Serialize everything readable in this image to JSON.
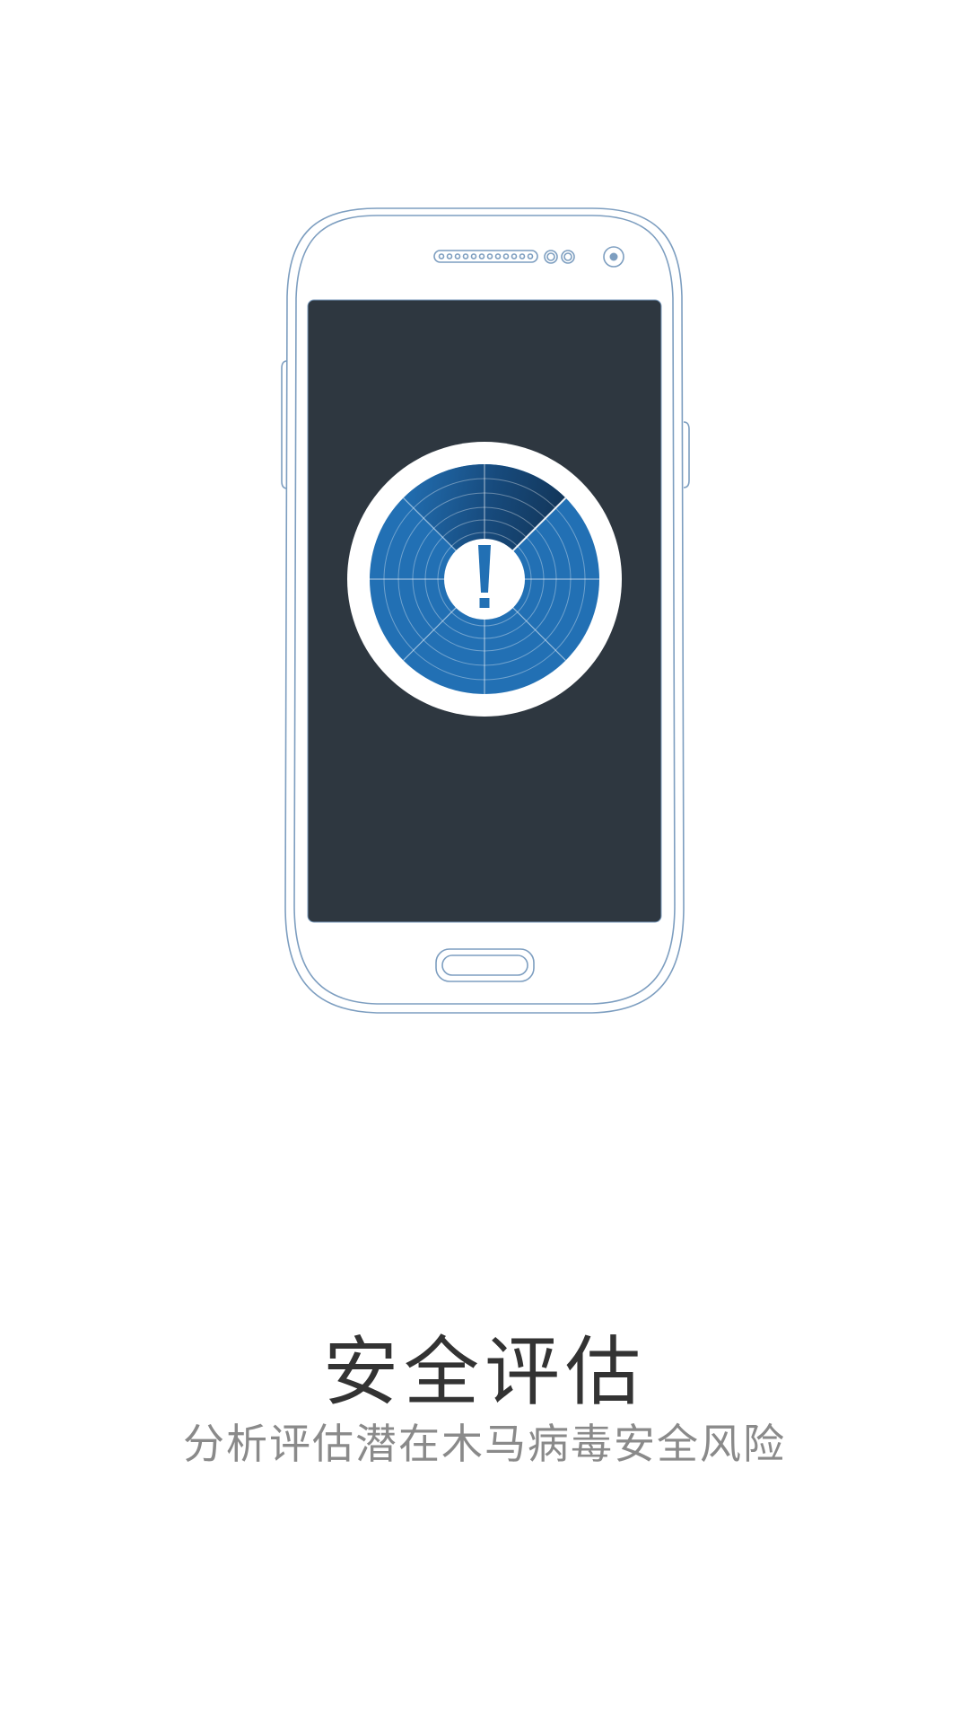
{
  "feature": {
    "title": "安全评估",
    "subtitle": "分析评估潜在木马病毒安全风险"
  },
  "illustration": {
    "device": "smartphone",
    "screen_icon": "radar-warning-icon",
    "symbol": "!",
    "colors": {
      "outline": "#7d9ec0",
      "screen": "#2e3740",
      "radar": "#2270b4",
      "radar_dark": "#123558",
      "ring": "#ffffff",
      "title": "#333333",
      "subtitle": "#8a8a8a"
    }
  }
}
